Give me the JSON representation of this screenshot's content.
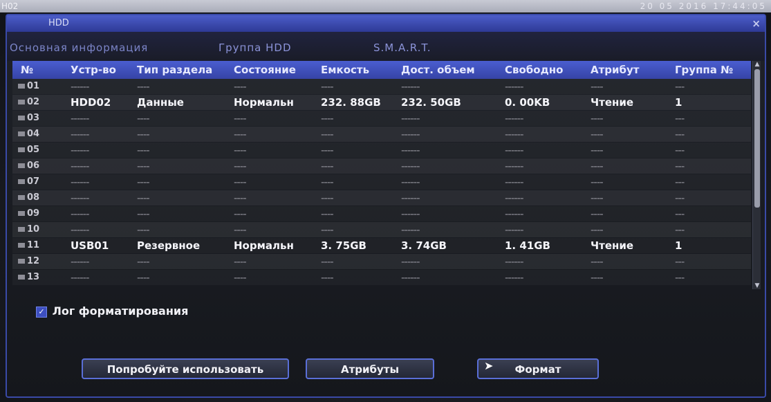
{
  "topbar": {
    "channel": "H02",
    "clock": "20  05  2016  17:44:05"
  },
  "window": {
    "title": "HDD",
    "close": "×"
  },
  "tabs": [
    {
      "label": "Основная информация"
    },
    {
      "label": "Группа HDD"
    },
    {
      "label": "S.M.A.R.T."
    }
  ],
  "table": {
    "headers": [
      "№",
      "Устр-во",
      "Тип раздела",
      "Состояние",
      "Емкость",
      "Дост. объем",
      "Свободно",
      "Атрибут",
      "Группа №"
    ],
    "rows": [
      [
        "01",
        "------",
        "----",
        "----",
        "----",
        "------",
        "------",
        "----",
        "---"
      ],
      [
        "02",
        "HDD02",
        "Данные",
        "Нормальн",
        "232. 88GB",
        "232. 50GB",
        "0. 00KB",
        "Чтение",
        "1"
      ],
      [
        "03",
        "------",
        "----",
        "----",
        "----",
        "------",
        "------",
        "----",
        "---"
      ],
      [
        "04",
        "------",
        "----",
        "----",
        "----",
        "------",
        "------",
        "----",
        "---"
      ],
      [
        "05",
        "------",
        "----",
        "----",
        "----",
        "------",
        "------",
        "----",
        "---"
      ],
      [
        "06",
        "------",
        "----",
        "----",
        "----",
        "------",
        "------",
        "----",
        "---"
      ],
      [
        "07",
        "------",
        "----",
        "----",
        "----",
        "------",
        "------",
        "----",
        "---"
      ],
      [
        "08",
        "------",
        "----",
        "----",
        "----",
        "------",
        "------",
        "----",
        "---"
      ],
      [
        "09",
        "------",
        "----",
        "----",
        "----",
        "------",
        "------",
        "----",
        "---"
      ],
      [
        "10",
        "------",
        "----",
        "----",
        "----",
        "------",
        "------",
        "----",
        "---"
      ],
      [
        "11",
        "USB01",
        "Резервное",
        "Нормальн",
        "3. 75GB",
        "3. 74GB",
        "1. 41GB",
        "Чтение",
        "1"
      ],
      [
        "12",
        "------",
        "----",
        "----",
        "----",
        "------",
        "------",
        "----",
        "---"
      ],
      [
        "13",
        "------",
        "----",
        "----",
        "----",
        "------",
        "------",
        "----",
        "---"
      ]
    ]
  },
  "format_log": {
    "label": "Лог форматирования",
    "checked": true,
    "check_glyph": "✓"
  },
  "buttons": {
    "try_use": "Попробуйте использовать",
    "attributes": "Атрибуты",
    "format": "Формат"
  },
  "colors": {
    "accent": "#3a4aa8",
    "header": "#4a5ed0",
    "button_border": "#5a6fd8"
  }
}
